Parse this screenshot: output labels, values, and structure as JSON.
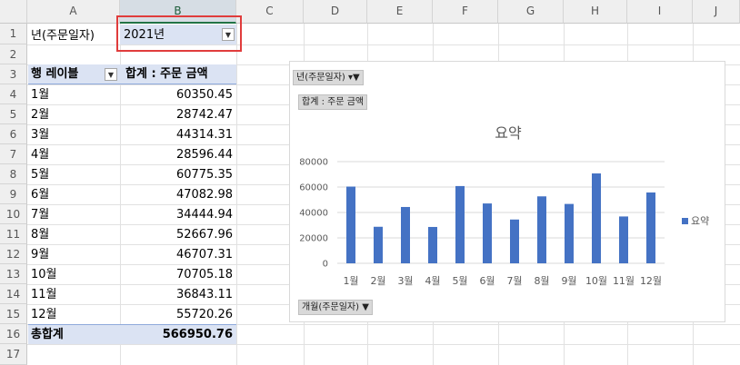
{
  "columns": [
    "A",
    "B",
    "C",
    "D",
    "E",
    "F",
    "G",
    "H",
    "I",
    "J"
  ],
  "rows": [
    "1",
    "2",
    "3",
    "4",
    "5",
    "6",
    "7",
    "8",
    "9",
    "10",
    "11",
    "12",
    "13",
    "14",
    "15",
    "16",
    "17"
  ],
  "filter": {
    "label": "년(주문일자)",
    "value": "2021년"
  },
  "pivot": {
    "header_row": "행 레이블",
    "header_value": "합계 : 주문 금액",
    "items": [
      {
        "label": "1월",
        "value": "60350.45"
      },
      {
        "label": "2월",
        "value": "28742.47"
      },
      {
        "label": "3월",
        "value": "44314.31"
      },
      {
        "label": "4월",
        "value": "28596.44"
      },
      {
        "label": "5월",
        "value": "60775.35"
      },
      {
        "label": "6월",
        "value": "47082.98"
      },
      {
        "label": "7월",
        "value": "34444.94"
      },
      {
        "label": "8월",
        "value": "52667.96"
      },
      {
        "label": "9월",
        "value": "46707.31"
      },
      {
        "label": "10월",
        "value": "70705.18"
      },
      {
        "label": "11월",
        "value": "36843.11"
      },
      {
        "label": "12월",
        "value": "55720.26"
      }
    ],
    "total_label": "총합계",
    "total_value": "566950.76"
  },
  "chart_buttons": {
    "filter_field": "년(주문일자)",
    "value_field": "합계 : 주문 금액",
    "axis_field": "개월(주문일자)"
  },
  "colors": {
    "bar": "#4472c4",
    "highlight": "#e03c3c",
    "pivot_header": "#dbe3f3"
  },
  "chart_data": {
    "type": "bar",
    "title": "요약",
    "categories": [
      "1월",
      "2월",
      "3월",
      "4월",
      "5월",
      "6월",
      "7월",
      "8월",
      "9월",
      "10월",
      "11월",
      "12월"
    ],
    "series": [
      {
        "name": "요약",
        "values": [
          60350.45,
          28742.47,
          44314.31,
          28596.44,
          60775.35,
          47082.98,
          34444.94,
          52667.96,
          46707.31,
          70705.18,
          36843.11,
          55720.26
        ]
      }
    ],
    "yticks": [
      "80000",
      "60000",
      "40000",
      "20000",
      "0"
    ],
    "ylim": [
      0,
      80000
    ],
    "legend": "right",
    "grid": true
  }
}
